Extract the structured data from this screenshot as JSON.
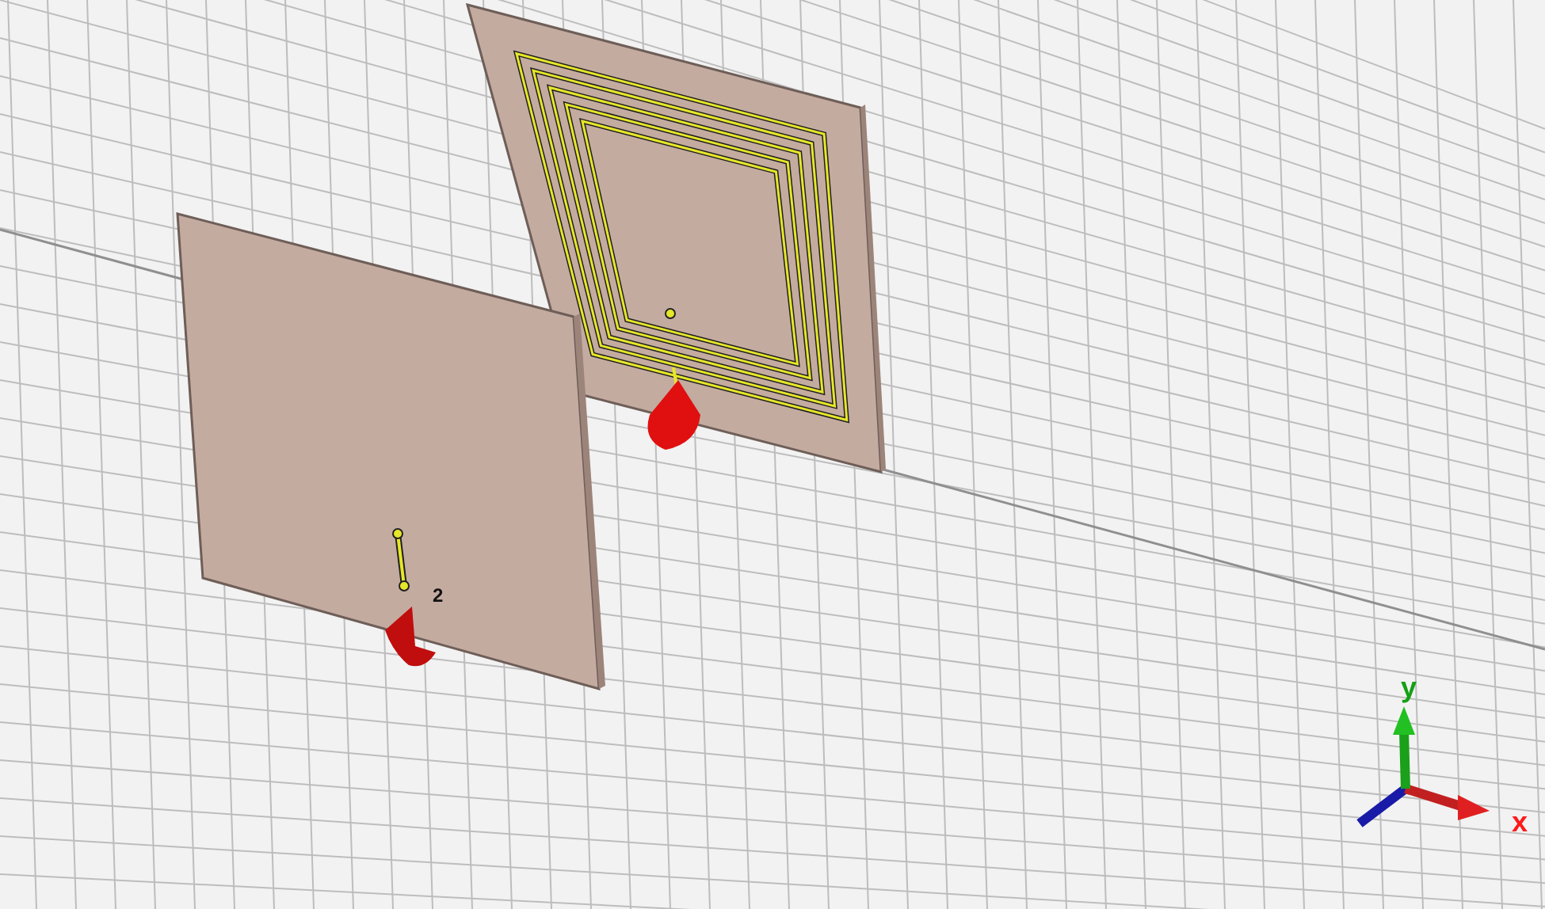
{
  "viewport": {
    "port_label": "2",
    "axes": [
      {
        "kind": "y",
        "label": "y"
      },
      {
        "kind": "x",
        "label": "x"
      }
    ]
  }
}
